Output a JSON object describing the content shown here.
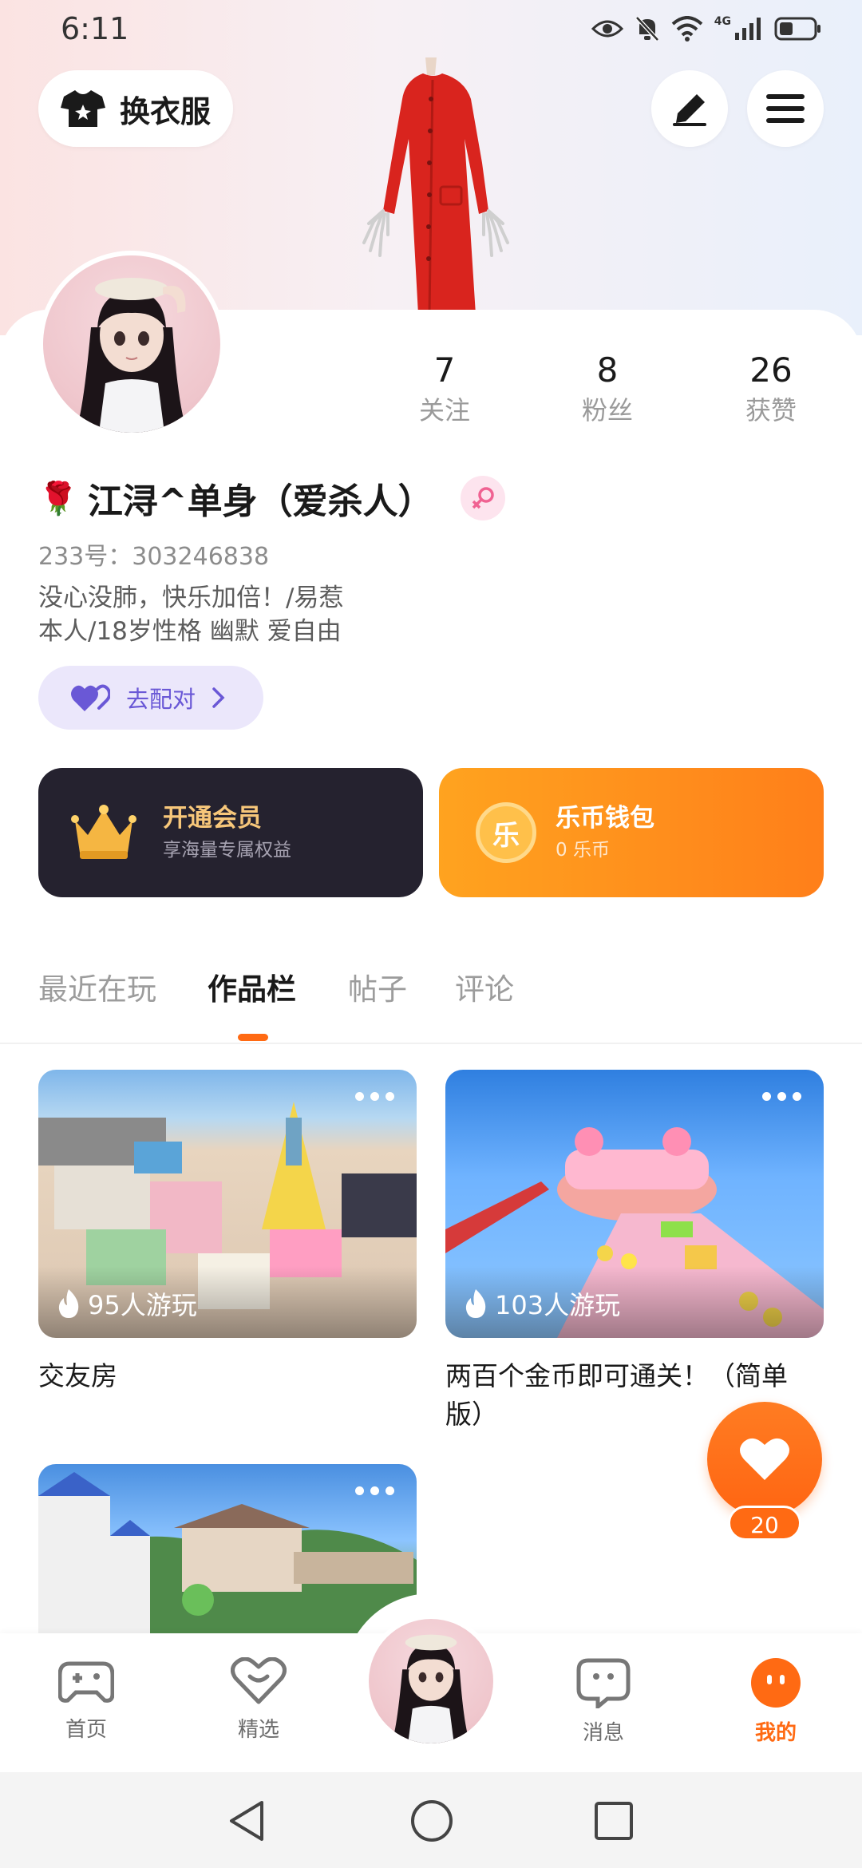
{
  "status_bar": {
    "time": "6:11",
    "network": "4G"
  },
  "header": {
    "wardrobe_label": "换衣服"
  },
  "profile": {
    "stats": [
      {
        "value": "7",
        "label": "关注"
      },
      {
        "value": "8",
        "label": "粉丝"
      },
      {
        "value": "26",
        "label": "获赞"
      }
    ],
    "name_emoji": "🌹",
    "name": "江浔^单身（爱杀人）",
    "uid": "233号：303246838",
    "bio_line1": "没心没肺，快乐加倍！/易惹",
    "bio_line2": "本人/18岁性格 幽默 爱自由",
    "match_label": "去配对"
  },
  "promos": {
    "vip": {
      "title": "开通会员",
      "subtitle": "享海量专属权益"
    },
    "wallet": {
      "title": "乐币钱包",
      "subtitle": "0 乐币",
      "coin_glyph": "乐"
    }
  },
  "tabs": [
    "最近在玩",
    "作品栏",
    "帖子",
    "评论"
  ],
  "active_tab": "作品栏",
  "works": [
    {
      "plays": "95人游玩",
      "title": "交友房"
    },
    {
      "plays": "103人游玩",
      "title_line1": "两百个金币即可通关！（简单",
      "title_line2": "版）"
    },
    {
      "plays": "",
      "title": ""
    }
  ],
  "like_fab": {
    "count": "20"
  },
  "bottom_nav": [
    {
      "label": "首页",
      "icon": "gamepad-icon"
    },
    {
      "label": "精选",
      "icon": "heart-badge-icon"
    },
    {
      "label": "",
      "icon": "avatar"
    },
    {
      "label": "消息",
      "icon": "chat-bubble-icon"
    },
    {
      "label": "我的",
      "icon": "me-icon"
    }
  ],
  "colors": {
    "accent": "#ff6a13",
    "purple": "#6a58d6",
    "vip_bg": "#25222f",
    "wallet": "#ff8a1a"
  }
}
